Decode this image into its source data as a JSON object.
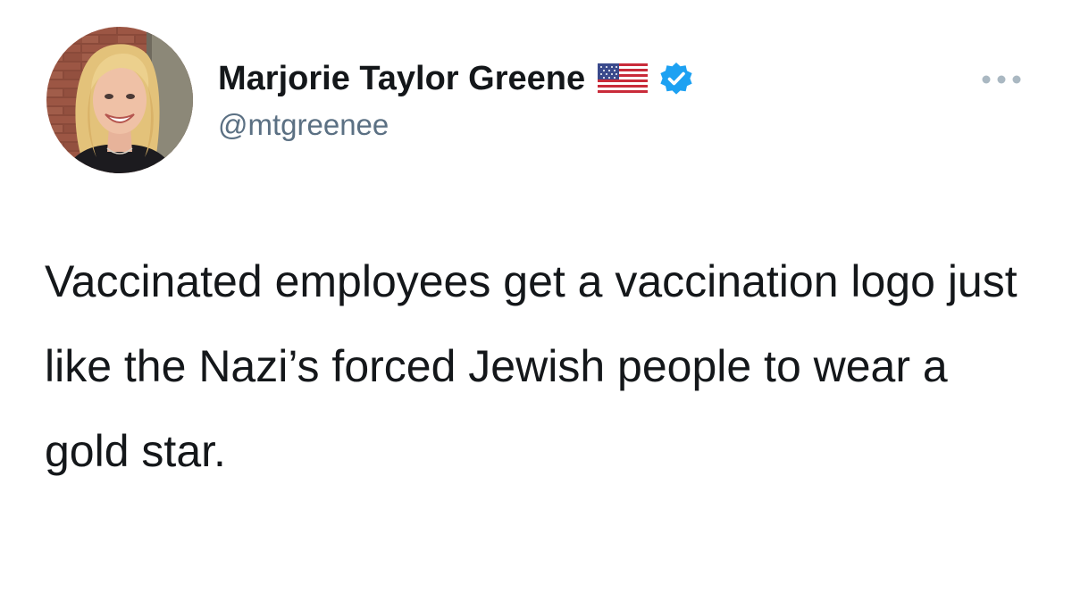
{
  "tweet": {
    "author": {
      "display_name": "Marjorie Taylor Greene",
      "handle": "@mtgreenee",
      "flag_icon": "us-flag-icon",
      "verified_icon": "verified-badge-icon",
      "avatar_icon": "profile-avatar"
    },
    "more_icon": "more-options-icon",
    "text": "Vaccinated employees get a vaccination logo just like the Nazi’s forced Jewish people to wear a gold star."
  },
  "colors": {
    "text_primary": "#14171a",
    "text_secondary": "#5b7083",
    "verified_blue": "#1da1f2",
    "background": "#ffffff"
  }
}
